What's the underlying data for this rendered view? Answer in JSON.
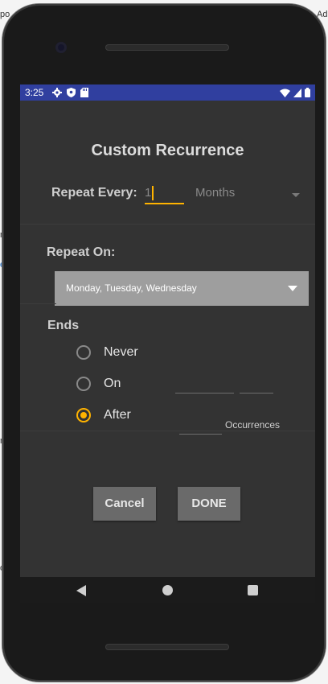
{
  "status_bar": {
    "time": "3:25",
    "left_icons": [
      "gear-icon",
      "shield-icon",
      "sd-card-icon"
    ],
    "right_icons": [
      "wifi-icon",
      "signal-icon",
      "battery-icon"
    ],
    "color": "#303f9f"
  },
  "dialog": {
    "title": "Custom Recurrence",
    "repeat_every": {
      "label": "Repeat Every:",
      "value": "1",
      "unit": "Months"
    },
    "repeat_on": {
      "label": "Repeat On:",
      "selected": "Monday, Tuesday, Wednesday"
    },
    "ends": {
      "label": "Ends",
      "options": [
        {
          "label": "Never",
          "checked": false
        },
        {
          "label": "On",
          "checked": false
        },
        {
          "label": "After",
          "checked": true
        }
      ],
      "occurrences_label": "Occurrences"
    },
    "buttons": {
      "cancel": "Cancel",
      "done": "DONE"
    },
    "accent_color": "#ffb300"
  },
  "nav": {
    "icons": [
      "back-icon",
      "home-icon",
      "recents-icon"
    ]
  },
  "background_fragments": [
    "po",
    "Ad",
    "r",
    "e",
    "r",
    "o"
  ]
}
